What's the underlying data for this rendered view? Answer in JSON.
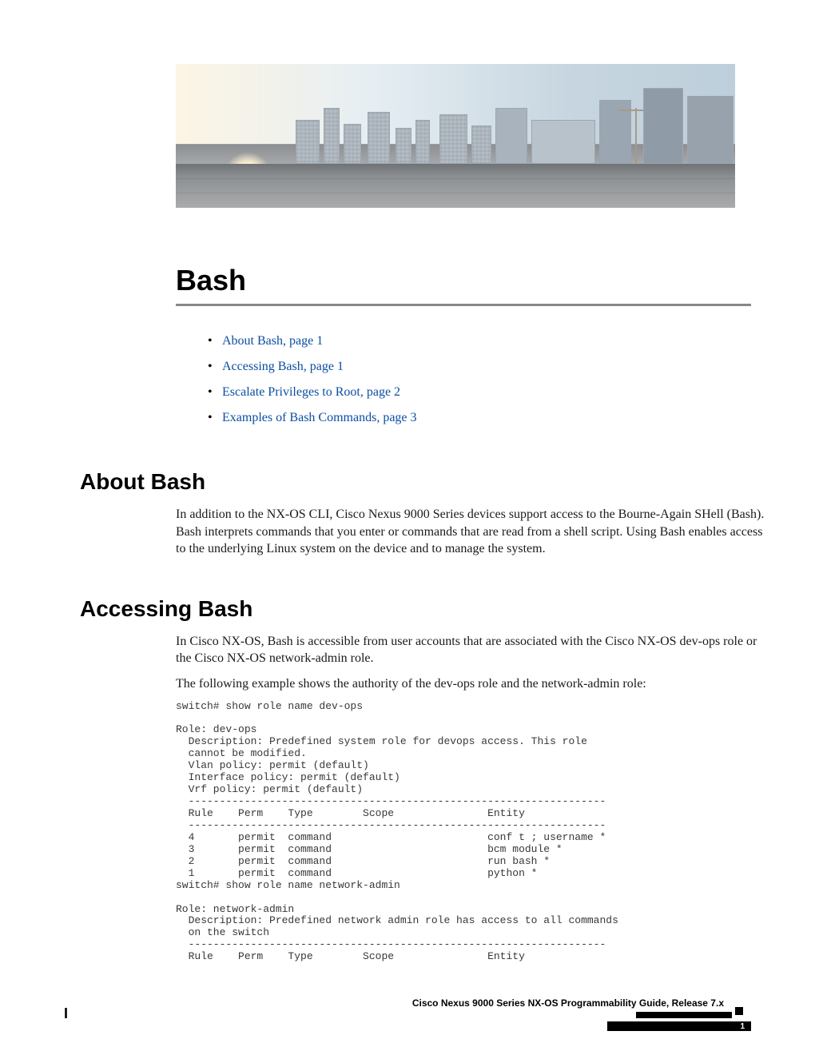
{
  "chapter": {
    "title": "Bash"
  },
  "toc": {
    "items": [
      {
        "label": "About Bash,  page  1"
      },
      {
        "label": "Accessing Bash,  page  1"
      },
      {
        "label": "Escalate Privileges to Root,  page  2"
      },
      {
        "label": "Examples of Bash Commands,  page  3"
      }
    ]
  },
  "sections": {
    "about": {
      "heading": "About Bash",
      "p1": "In addition to the NX-OS CLI, Cisco Nexus 9000 Series devices support access to the Bourne-Again SHell (Bash). Bash interprets commands that you enter or commands that are read from a shell script. Using Bash enables access to the underlying Linux system on the device and to manage the system."
    },
    "accessing": {
      "heading": "Accessing Bash",
      "p1": "In Cisco NX-OS, Bash is accessible from user accounts that are associated with the Cisco NX-OS dev-ops role or the Cisco NX-OS network-admin role.",
      "p2": "The following example shows the authority of the dev-ops role and the network-admin role:",
      "code": "switch# show role name dev-ops\n\nRole: dev-ops\n  Description: Predefined system role for devops access. This role\n  cannot be modified.\n  Vlan policy: permit (default)\n  Interface policy: permit (default)\n  Vrf policy: permit (default)\n  -------------------------------------------------------------------\n  Rule    Perm    Type        Scope               Entity\n  -------------------------------------------------------------------\n  4       permit  command                         conf t ; username *\n  3       permit  command                         bcm module *\n  2       permit  command                         run bash *\n  1       permit  command                         python *\nswitch# show role name network-admin\n\nRole: network-admin\n  Description: Predefined network admin role has access to all commands\n  on the switch\n  -------------------------------------------------------------------\n  Rule    Perm    Type        Scope               Entity"
    }
  },
  "footer": {
    "guide_title": "Cisco Nexus 9000 Series NX-OS Programmability Guide, Release 7.x",
    "page_number": "1",
    "left_mark": "I"
  }
}
